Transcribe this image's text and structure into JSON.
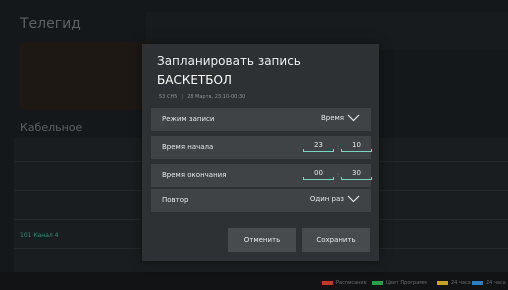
{
  "background": {
    "title": "Телегид",
    "section_label": "Кабельное",
    "channel_text": "101   Канал 4"
  },
  "legend": [
    {
      "label": "Расписание",
      "color": "#c0392b"
    },
    {
      "label": "Цвет Программ",
      "color": "#2e9d4a"
    },
    {
      "label": "24 часа",
      "color": "#c9a227"
    },
    {
      "label": "24 часа",
      "color": "#2a7fbf"
    }
  ],
  "dialog": {
    "title": "Запланировать запись",
    "program": "БАСКЕТБОЛ",
    "channel": "53 CH5",
    "datetime": "28 Марта, 23:10-00:30",
    "rows": {
      "mode": {
        "label": "Режим записи",
        "value": "Время"
      },
      "start": {
        "label": "Время начала",
        "hours": "23",
        "minutes": "10"
      },
      "end": {
        "label": "Время окончания",
        "hours": "00",
        "minutes": "30"
      },
      "repeat": {
        "label": "Повтор",
        "value": "Один раз"
      }
    },
    "buttons": {
      "cancel": "Отменить",
      "save": "Сохранить"
    }
  },
  "colors": {
    "accent": "#7fd6c0",
    "dialog_bg": "#2d3133",
    "row_bg": "#3f4345"
  }
}
